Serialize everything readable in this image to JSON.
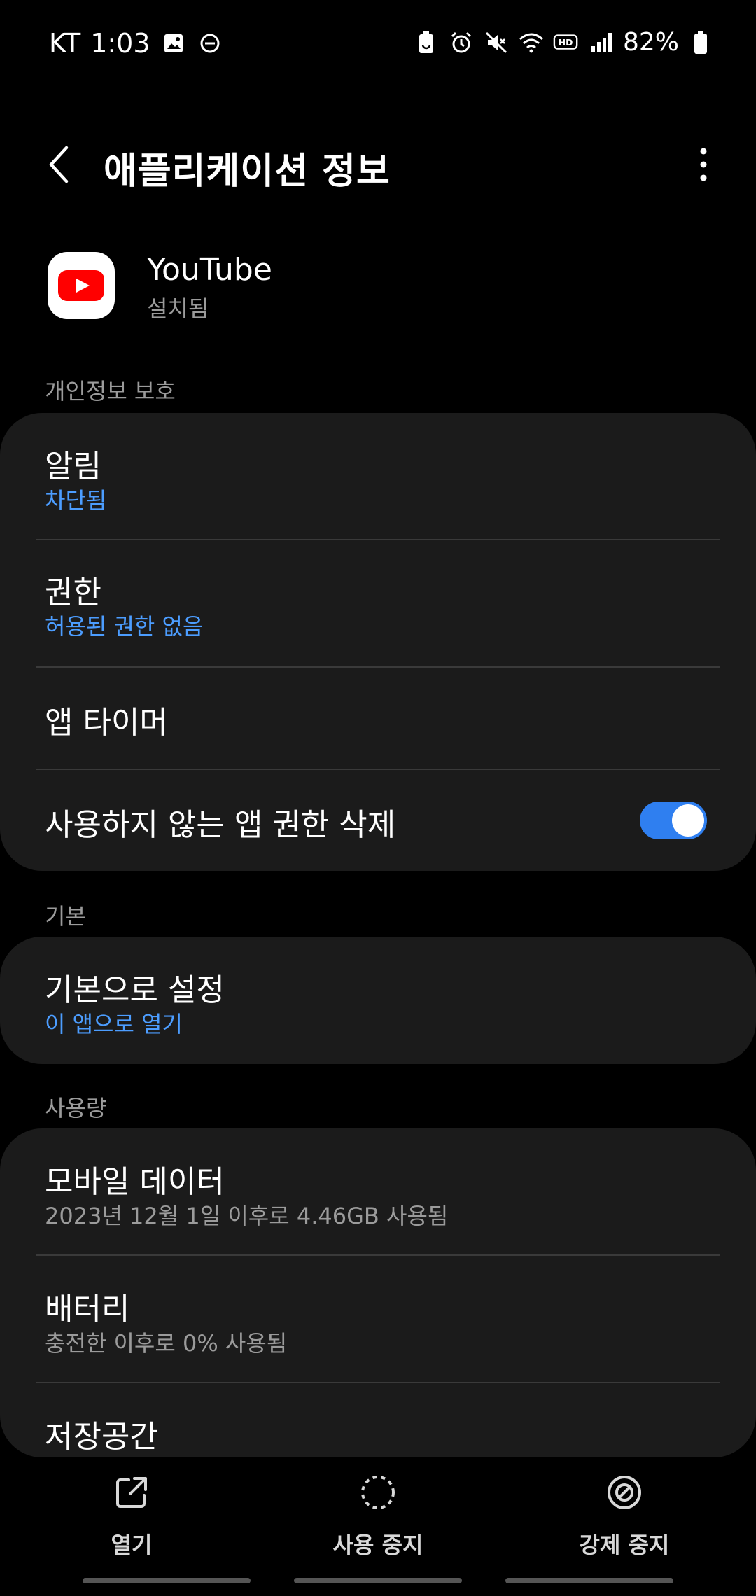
{
  "status_bar": {
    "carrier": "KT",
    "time": "1:03",
    "battery_percent": "82%",
    "icons_left": [
      "image-icon",
      "dnd-icon"
    ],
    "icons_right": [
      "battery-saver-icon",
      "alarm-icon",
      "mute-icon",
      "wifi-icon",
      "hd-icon",
      "signal-icon",
      "battery-icon"
    ]
  },
  "header": {
    "title": "애플리케이션 정보"
  },
  "app": {
    "name": "YouTube",
    "status": "설치됨",
    "brand_color": "#FF0000"
  },
  "sections": {
    "privacy": {
      "label": "개인정보 보호",
      "items": [
        {
          "title": "알림",
          "subtitle": "차단됨"
        },
        {
          "title": "권한",
          "subtitle": "허용된 권한 없음"
        },
        {
          "title": "앱 타이머"
        },
        {
          "title": "사용하지 않는 앱 권한 삭제",
          "toggle_on": true
        }
      ]
    },
    "default": {
      "label": "기본",
      "items": [
        {
          "title": "기본으로 설정",
          "subtitle": "이 앱으로 열기"
        }
      ]
    },
    "usage": {
      "label": "사용량",
      "items": [
        {
          "title": "모바일 데이터",
          "subtitle": "2023년 12월 1일 이후로 4.46GB 사용됨"
        },
        {
          "title": "배터리",
          "subtitle": "충전한 이후로 0% 사용됨"
        },
        {
          "title": "저장공간"
        }
      ]
    }
  },
  "bottom_actions": {
    "open": "열기",
    "disable": "사용 중지",
    "force_stop": "강제 중지"
  },
  "colors": {
    "accent_blue": "#4C9DFF",
    "toggle_blue": "#2F7FF0",
    "card_bg": "#1B1B1B"
  }
}
